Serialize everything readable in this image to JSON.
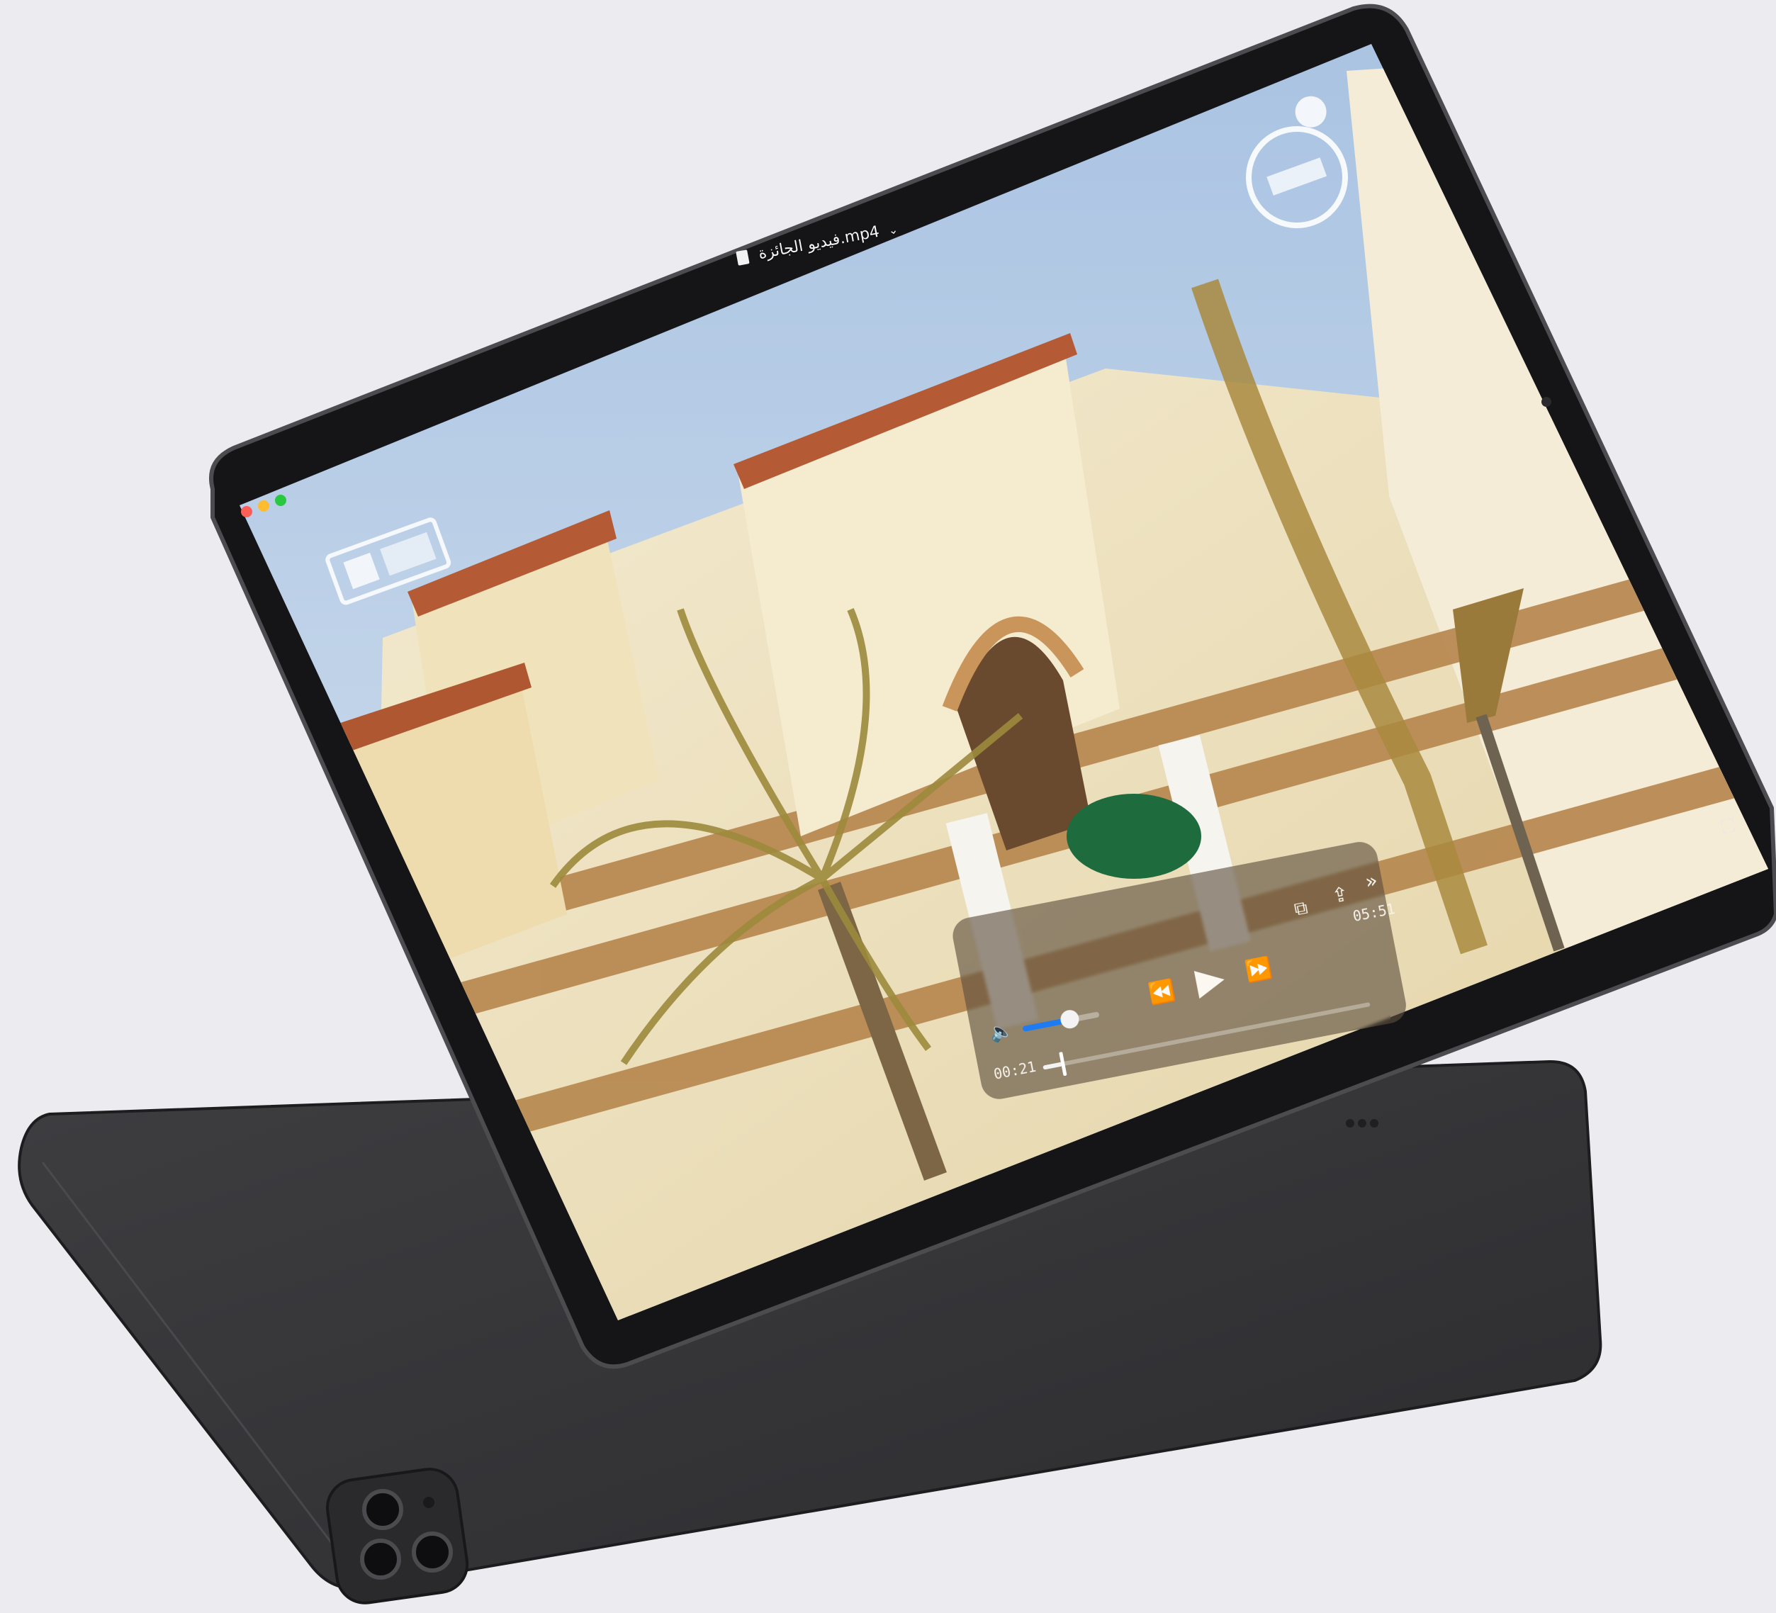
{
  "window": {
    "title": "فيديو الجائزة.mp4",
    "traffic_lights": [
      "#ff5f57",
      "#febc2e",
      "#28c840"
    ]
  },
  "player": {
    "elapsed_time": "00:21",
    "total_time": "05:51",
    "progress_fraction": 0.06,
    "volume_fraction": 0.62,
    "icons": [
      "speaker-icon",
      "rewind-icon",
      "play-icon",
      "fast-forward-icon",
      "picture-in-picture-icon",
      "share-icon",
      "collapse-icon",
      "fullscreen-icon"
    ]
  },
  "overlay_logos": [
    "building-logo",
    "ajyalona-logo"
  ],
  "accent_colors": {
    "volume_fill": "#1f7bf2",
    "device_body": "#3b3b3e",
    "bezel": "#0d0d0f"
  }
}
